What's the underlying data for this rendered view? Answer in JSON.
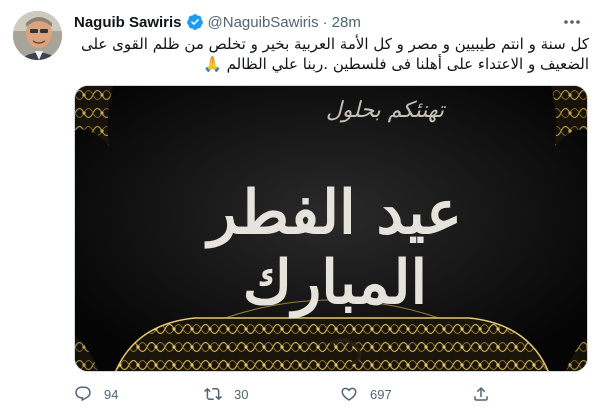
{
  "tweet": {
    "author_name": "Naguib Sawiris",
    "handle": "@NaguibSawiris",
    "separator": "·",
    "time": "28m",
    "text_lines": [
      "كل سنة و انتم طيبيين و مصر و كل الأمة العربية بخير و تخلص من ظلم القوى على",
      "الضعيف و الاعتداء على أهلنا فى فلسطين .ربنا علي الظالم 🙏"
    ],
    "media": {
      "greeting_top": "تهنئكم بحلول",
      "greeting_main": "عيد الفطر المبارك"
    },
    "actions": {
      "replies": "94",
      "retweets": "30",
      "likes": "697"
    }
  },
  "icons": {
    "verified": "verified-badge-icon",
    "more": "more-icon",
    "reply": "reply-icon",
    "retweet": "retweet-icon",
    "like": "heart-icon",
    "share": "share-icon"
  },
  "colors": {
    "text": "#0f1419",
    "secondary": "#536471",
    "verified": "#1d9bf0",
    "border": "#cfd9de",
    "gold": "#c9a84a"
  }
}
